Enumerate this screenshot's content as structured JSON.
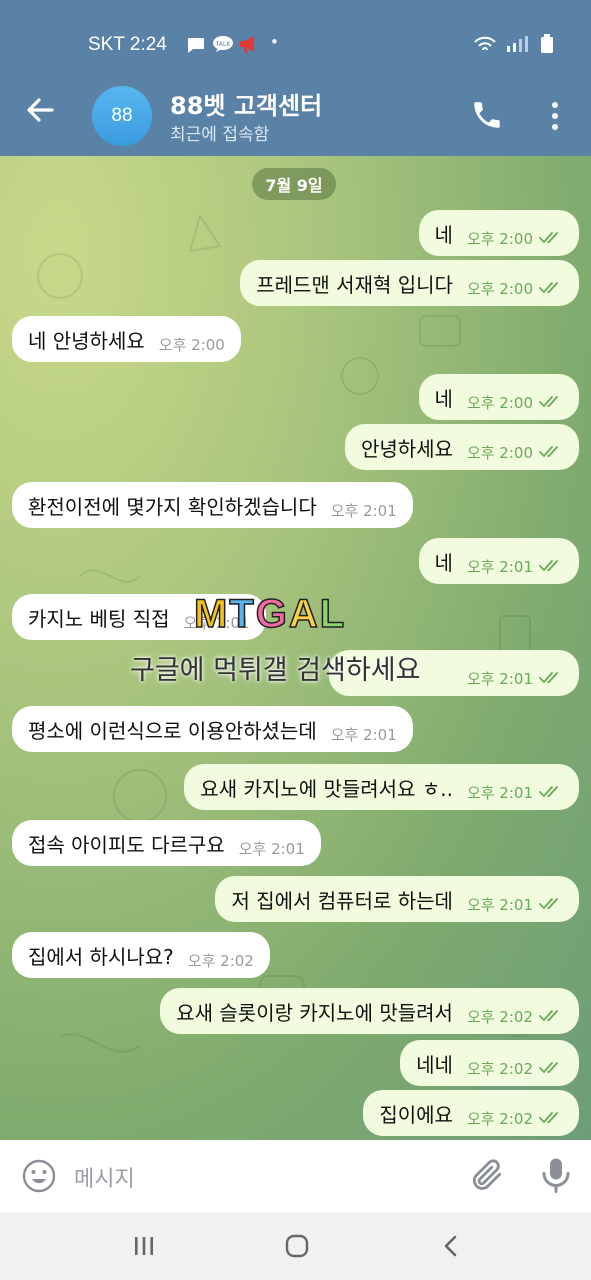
{
  "status": {
    "carrier_time": "SKT 2:24",
    "dot": "•"
  },
  "header": {
    "avatar_text": "88",
    "title": "88벳 고객센터",
    "subtitle": "최근에 접속함"
  },
  "date_chip": "7월 9일",
  "messages": [
    {
      "dir": "out",
      "text": "네",
      "time": "오후 2:00",
      "read": true
    },
    {
      "dir": "out",
      "text": "프레드맨 서재혁 입니다",
      "time": "오후 2:00",
      "read": true
    },
    {
      "dir": "in",
      "text": "네 안녕하세요",
      "time": "오후 2:00"
    },
    {
      "dir": "out",
      "text": "네",
      "time": "오후 2:00",
      "read": true
    },
    {
      "dir": "out",
      "text": "안녕하세요",
      "time": "오후 2:00",
      "read": true
    },
    {
      "dir": "in",
      "text": "환전이전에 몇가지 확인하겠습니다",
      "time": "오후 2:01"
    },
    {
      "dir": "out",
      "text": "네",
      "time": "오후 2:01",
      "read": true
    },
    {
      "dir": "in",
      "text": "카지노 베팅 직접",
      "time": "오후 2:01"
    },
    {
      "dir": "out",
      "text": "",
      "time": "오후 2:01",
      "read": true
    },
    {
      "dir": "in",
      "text": "평소에 이런식으로 이용안하셨는데",
      "time": "오후 2:01"
    },
    {
      "dir": "out",
      "text": "요새 카지노에 맛들려서요 ㅎ..",
      "time": "오후 2:01",
      "read": true
    },
    {
      "dir": "in",
      "text": "접속 아이피도 다르구요",
      "time": "오후 2:01"
    },
    {
      "dir": "out",
      "text": "저 집에서 컴퓨터로 하는데",
      "time": "오후 2:01",
      "read": true
    },
    {
      "dir": "in",
      "text": "집에서 하시나요?",
      "time": "오후 2:02"
    },
    {
      "dir": "out",
      "text": "요새 슬롯이랑 카지노에 맛들려서",
      "time": "오후 2:02",
      "read": true
    },
    {
      "dir": "out",
      "text": "네네",
      "time": "오후 2:02",
      "read": true
    },
    {
      "dir": "out",
      "text": "집이에요",
      "time": "오후 2:02",
      "read": true
    }
  ],
  "watermark": {
    "logo": "MTGAL",
    "text": "구글에 먹튀갤 검색하세요"
  },
  "input": {
    "placeholder": "메시지"
  },
  "colors": {
    "header": "#5a82a6",
    "outgoing_bubble": "#f0fcdd",
    "incoming_bubble": "#ffffff",
    "check": "#6ba85a"
  }
}
